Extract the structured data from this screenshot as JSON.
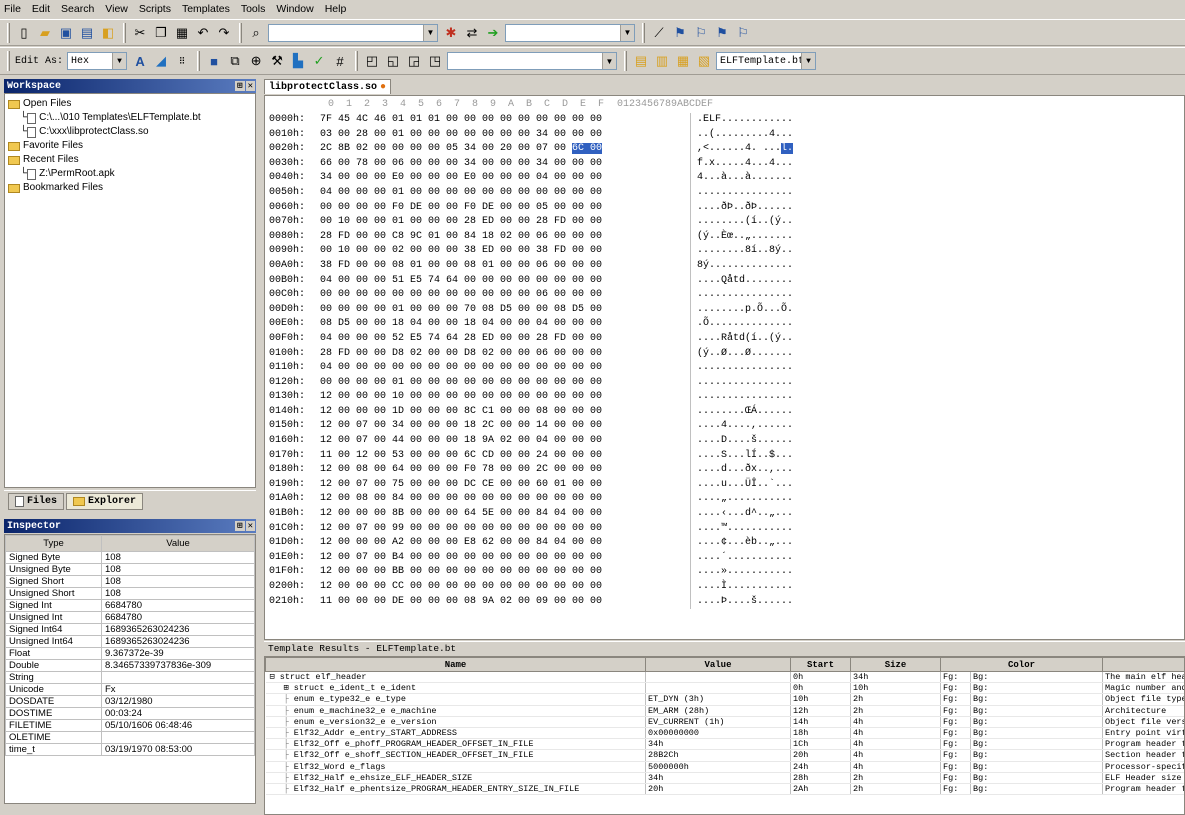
{
  "menu": [
    "File",
    "Edit",
    "Search",
    "View",
    "Scripts",
    "Templates",
    "Tools",
    "Window",
    "Help"
  ],
  "toolbar": {
    "edit_as_label": "Edit As:",
    "edit_as_value": "Hex",
    "template_combo": "ELFTemplate.bt"
  },
  "workspace": {
    "title": "Workspace",
    "groups": [
      {
        "label": "Open Files",
        "items": [
          "C:\\...\\010 Templates\\ELFTemplate.bt",
          "C:\\xxx\\libprotectClass.so"
        ]
      },
      {
        "label": "Favorite Files",
        "items": []
      },
      {
        "label": "Recent Files",
        "items": [
          "Z:\\PermRoot.apk"
        ]
      },
      {
        "label": "Bookmarked Files",
        "items": []
      }
    ],
    "tabs": [
      "Files",
      "Explorer"
    ]
  },
  "inspector": {
    "title": "Inspector",
    "columns": [
      "Type",
      "Value"
    ],
    "rows": [
      [
        "Signed Byte",
        "108"
      ],
      [
        "Unsigned Byte",
        "108"
      ],
      [
        "Signed Short",
        "108"
      ],
      [
        "Unsigned Short",
        "108"
      ],
      [
        "Signed Int",
        "6684780"
      ],
      [
        "Unsigned Int",
        "6684780"
      ],
      [
        "Signed Int64",
        "1689365263024236"
      ],
      [
        "Unsigned Int64",
        "1689365263024236"
      ],
      [
        "Float",
        "9.367372e-39"
      ],
      [
        "Double",
        "8.34657339737836e-309"
      ],
      [
        "String",
        ""
      ],
      [
        "Unicode",
        "Fx"
      ],
      [
        "DOSDATE",
        "03/12/1980"
      ],
      [
        "DOSTIME",
        "00:03:24"
      ],
      [
        "FILETIME",
        "05/10/1606 06:48:46"
      ],
      [
        "OLETIME",
        ""
      ],
      [
        "time_t",
        "03/19/1970 08:53:00"
      ]
    ]
  },
  "document": {
    "tab": "libprotectClass.so",
    "header_cols": "0  1  2  3  4  5  6  7  8  9  A  B  C  D  E  F",
    "header_ascii": "0123456789ABCDEF",
    "rows": [
      {
        "addr": "0000h:",
        "bytes": "7F 45 4C 46 01 01 01 00 00 00 00 00 00 00 00 00",
        "ascii": ".ELF............"
      },
      {
        "addr": "0010h:",
        "bytes": "03 00 28 00 01 00 00 00 00 00 00 00 34 00 00 00",
        "ascii": "..(.........4..."
      },
      {
        "addr": "0020h:",
        "bytes": "2C 8B 02 00 00 00 00 05 34 00 20 00 07 00 ",
        "sel": "6C 00",
        "ascii": ",<......4. ...",
        "asel": "l."
      },
      {
        "addr": "0030h:",
        "bytes": "66 00 78 00 06 00 00 00 34 00 00 00 34 00 00 00",
        "ascii": "f.x.....4...4..."
      },
      {
        "addr": "0040h:",
        "bytes": "34 00 00 00 E0 00 00 00 E0 00 00 00 04 00 00 00",
        "ascii": "4...à...à......."
      },
      {
        "addr": "0050h:",
        "bytes": "04 00 00 00 01 00 00 00 00 00 00 00 00 00 00 00",
        "ascii": "................"
      },
      {
        "addr": "0060h:",
        "bytes": "00 00 00 00 F0 DE 00 00 F0 DE 00 00 05 00 00 00",
        "ascii": "....ðÞ..ðÞ......"
      },
      {
        "addr": "0070h:",
        "bytes": "00 10 00 00 01 00 00 00 28 ED 00 00 28 FD 00 00",
        "ascii": "........(í..(ý.."
      },
      {
        "addr": "0080h:",
        "bytes": "28 FD 00 00 C8 9C 01 00 84 18 02 00 06 00 00 00",
        "ascii": "(ý..Èœ..„......."
      },
      {
        "addr": "0090h:",
        "bytes": "00 10 00 00 02 00 00 00 38 ED 00 00 38 FD 00 00",
        "ascii": "........8í..8ý.."
      },
      {
        "addr": "00A0h:",
        "bytes": "38 FD 00 00 08 01 00 00 08 01 00 00 06 00 00 00",
        "ascii": "8ý.............."
      },
      {
        "addr": "00B0h:",
        "bytes": "04 00 00 00 51 E5 74 64 00 00 00 00 00 00 00 00",
        "ascii": "....Qåtd........"
      },
      {
        "addr": "00C0h:",
        "bytes": "00 00 00 00 00 00 00 00 00 00 00 00 06 00 00 00",
        "ascii": "................"
      },
      {
        "addr": "00D0h:",
        "bytes": "00 00 00 00 01 00 00 00 70 08 D5 00 00 08 D5 00",
        "ascii": "........p.Õ...Õ."
      },
      {
        "addr": "00E0h:",
        "bytes": "08 D5 00 00 18 04 00 00 18 04 00 00 04 00 00 00",
        "ascii": ".Õ.............."
      },
      {
        "addr": "00F0h:",
        "bytes": "04 00 00 00 52 E5 74 64 28 ED 00 00 28 FD 00 00",
        "ascii": "....Råtd(í..(ý.."
      },
      {
        "addr": "0100h:",
        "bytes": "28 FD 00 00 D8 02 00 00 D8 02 00 00 06 00 00 00",
        "ascii": "(ý..Ø...Ø......."
      },
      {
        "addr": "0110h:",
        "bytes": "04 00 00 00 00 00 00 00 00 00 00 00 00 00 00 00",
        "ascii": "................"
      },
      {
        "addr": "0120h:",
        "bytes": "00 00 00 00 01 00 00 00 00 00 00 00 00 00 00 00",
        "ascii": "................"
      },
      {
        "addr": "0130h:",
        "bytes": "12 00 00 00 10 00 00 00 00 00 00 00 00 00 00 00",
        "ascii": "................"
      },
      {
        "addr": "0140h:",
        "bytes": "12 00 00 00 1D 00 00 00 8C C1 00 00 08 00 00 00",
        "ascii": "........ŒÁ......"
      },
      {
        "addr": "0150h:",
        "bytes": "12 00 07 00 34 00 00 00 18 2C 00 00 14 00 00 00",
        "ascii": "....4....,......"
      },
      {
        "addr": "0160h:",
        "bytes": "12 00 07 00 44 00 00 00 18 9A 02 00 04 00 00 00",
        "ascii": "....D....š......"
      },
      {
        "addr": "0170h:",
        "bytes": "11 00 12 00 53 00 00 00 6C CD 00 00 24 00 00 00",
        "ascii": "....S...lÍ..$..."
      },
      {
        "addr": "0180h:",
        "bytes": "12 00 08 00 64 00 00 00 F0 78 00 00 2C 00 00 00",
        "ascii": "....d...ðx..,..."
      },
      {
        "addr": "0190h:",
        "bytes": "12 00 07 00 75 00 00 00 DC CE 00 00 60 01 00 00",
        "ascii": "....u...ÜÎ..`..."
      },
      {
        "addr": "01A0h:",
        "bytes": "12 00 08 00 84 00 00 00 00 00 00 00 00 00 00 00",
        "ascii": "....„..........."
      },
      {
        "addr": "01B0h:",
        "bytes": "12 00 00 00 8B 00 00 00 64 5E 00 00 84 04 00 00",
        "ascii": "....‹...d^..„..."
      },
      {
        "addr": "01C0h:",
        "bytes": "12 00 07 00 99 00 00 00 00 00 00 00 00 00 00 00",
        "ascii": "....™..........."
      },
      {
        "addr": "01D0h:",
        "bytes": "12 00 00 00 A2 00 00 00 E8 62 00 00 84 04 00 00",
        "ascii": "....¢...èb..„..."
      },
      {
        "addr": "01E0h:",
        "bytes": "12 00 07 00 B4 00 00 00 00 00 00 00 00 00 00 00",
        "ascii": "....´..........."
      },
      {
        "addr": "01F0h:",
        "bytes": "12 00 00 00 BB 00 00 00 00 00 00 00 00 00 00 00",
        "ascii": "....»..........."
      },
      {
        "addr": "0200h:",
        "bytes": "12 00 00 00 CC 00 00 00 00 00 00 00 00 00 00 00",
        "ascii": "....Ì..........."
      },
      {
        "addr": "0210h:",
        "bytes": "11 00 00 00 DE 00 00 00 08 9A 02 00 09 00 00 00",
        "ascii": "....Þ....š......"
      }
    ]
  },
  "template": {
    "bar_label": "Template Results - ELFTemplate.bt",
    "columns": [
      "Name",
      "Value",
      "Start",
      "Size",
      "Color",
      ""
    ],
    "rows": [
      {
        "name": "struct elf_header",
        "value": "",
        "start": "0h",
        "size": "34h",
        "fg": "Fg:",
        "bg": "Bg:",
        "comment": "The main elf header ba",
        "indent": 0,
        "sign": "−"
      },
      {
        "name": "struct e_ident_t e_ident",
        "value": "",
        "start": "0h",
        "size": "10h",
        "fg": "Fg:",
        "bg": "Bg:",
        "comment": "Magic number and other",
        "indent": 1,
        "sign": "+"
      },
      {
        "name": "enum e_type32_e e_type",
        "value": "ET_DYN (3h)",
        "start": "10h",
        "size": "2h",
        "fg": "Fg:",
        "bg": "Bg:",
        "comment": "Object file type",
        "indent": 1,
        "sign": ""
      },
      {
        "name": "enum e_machine32_e e_machine",
        "value": "EM_ARM (28h)",
        "start": "12h",
        "size": "2h",
        "fg": "Fg:",
        "bg": "Bg:",
        "comment": "Architecture",
        "indent": 1,
        "sign": ""
      },
      {
        "name": "enum e_version32_e e_version",
        "value": "EV_CURRENT (1h)",
        "start": "14h",
        "size": "4h",
        "fg": "Fg:",
        "bg": "Bg:",
        "comment": "Object file version",
        "indent": 1,
        "sign": ""
      },
      {
        "name": "Elf32_Addr e_entry_START_ADDRESS",
        "value": "0x00000000",
        "start": "18h",
        "size": "4h",
        "fg": "Fg:",
        "bg": "Bg:",
        "comment": "Entry point virtual ad",
        "indent": 1,
        "sign": ""
      },
      {
        "name": "Elf32_Off e_phoff_PROGRAM_HEADER_OFFSET_IN_FILE",
        "value": "34h",
        "start": "1Ch",
        "size": "4h",
        "fg": "Fg:",
        "bg": "Bg:",
        "comment": "Program header table f",
        "indent": 1,
        "sign": ""
      },
      {
        "name": "Elf32_Off e_shoff_SECTION_HEADER_OFFSET_IN_FILE",
        "value": "28B2Ch",
        "start": "20h",
        "size": "4h",
        "fg": "Fg:",
        "bg": "Bg:",
        "comment": "Section header table f",
        "indent": 1,
        "sign": ""
      },
      {
        "name": "Elf32_Word e_flags",
        "value": "5000000h",
        "start": "24h",
        "size": "4h",
        "fg": "Fg:",
        "bg": "Bg:",
        "comment": "Processor-specific fla",
        "indent": 1,
        "sign": ""
      },
      {
        "name": "Elf32_Half e_ehsize_ELF_HEADER_SIZE",
        "value": "34h",
        "start": "28h",
        "size": "2h",
        "fg": "Fg:",
        "bg": "Bg:",
        "comment": "ELF Header size in byt",
        "indent": 1,
        "sign": ""
      },
      {
        "name": "Elf32_Half e_phentsize_PROGRAM_HEADER_ENTRY_SIZE_IN_FILE",
        "value": "20h",
        "start": "2Ah",
        "size": "2h",
        "fg": "Fg:",
        "bg": "Bg:",
        "comment": "Program header table e",
        "indent": 1,
        "sign": ""
      }
    ]
  }
}
